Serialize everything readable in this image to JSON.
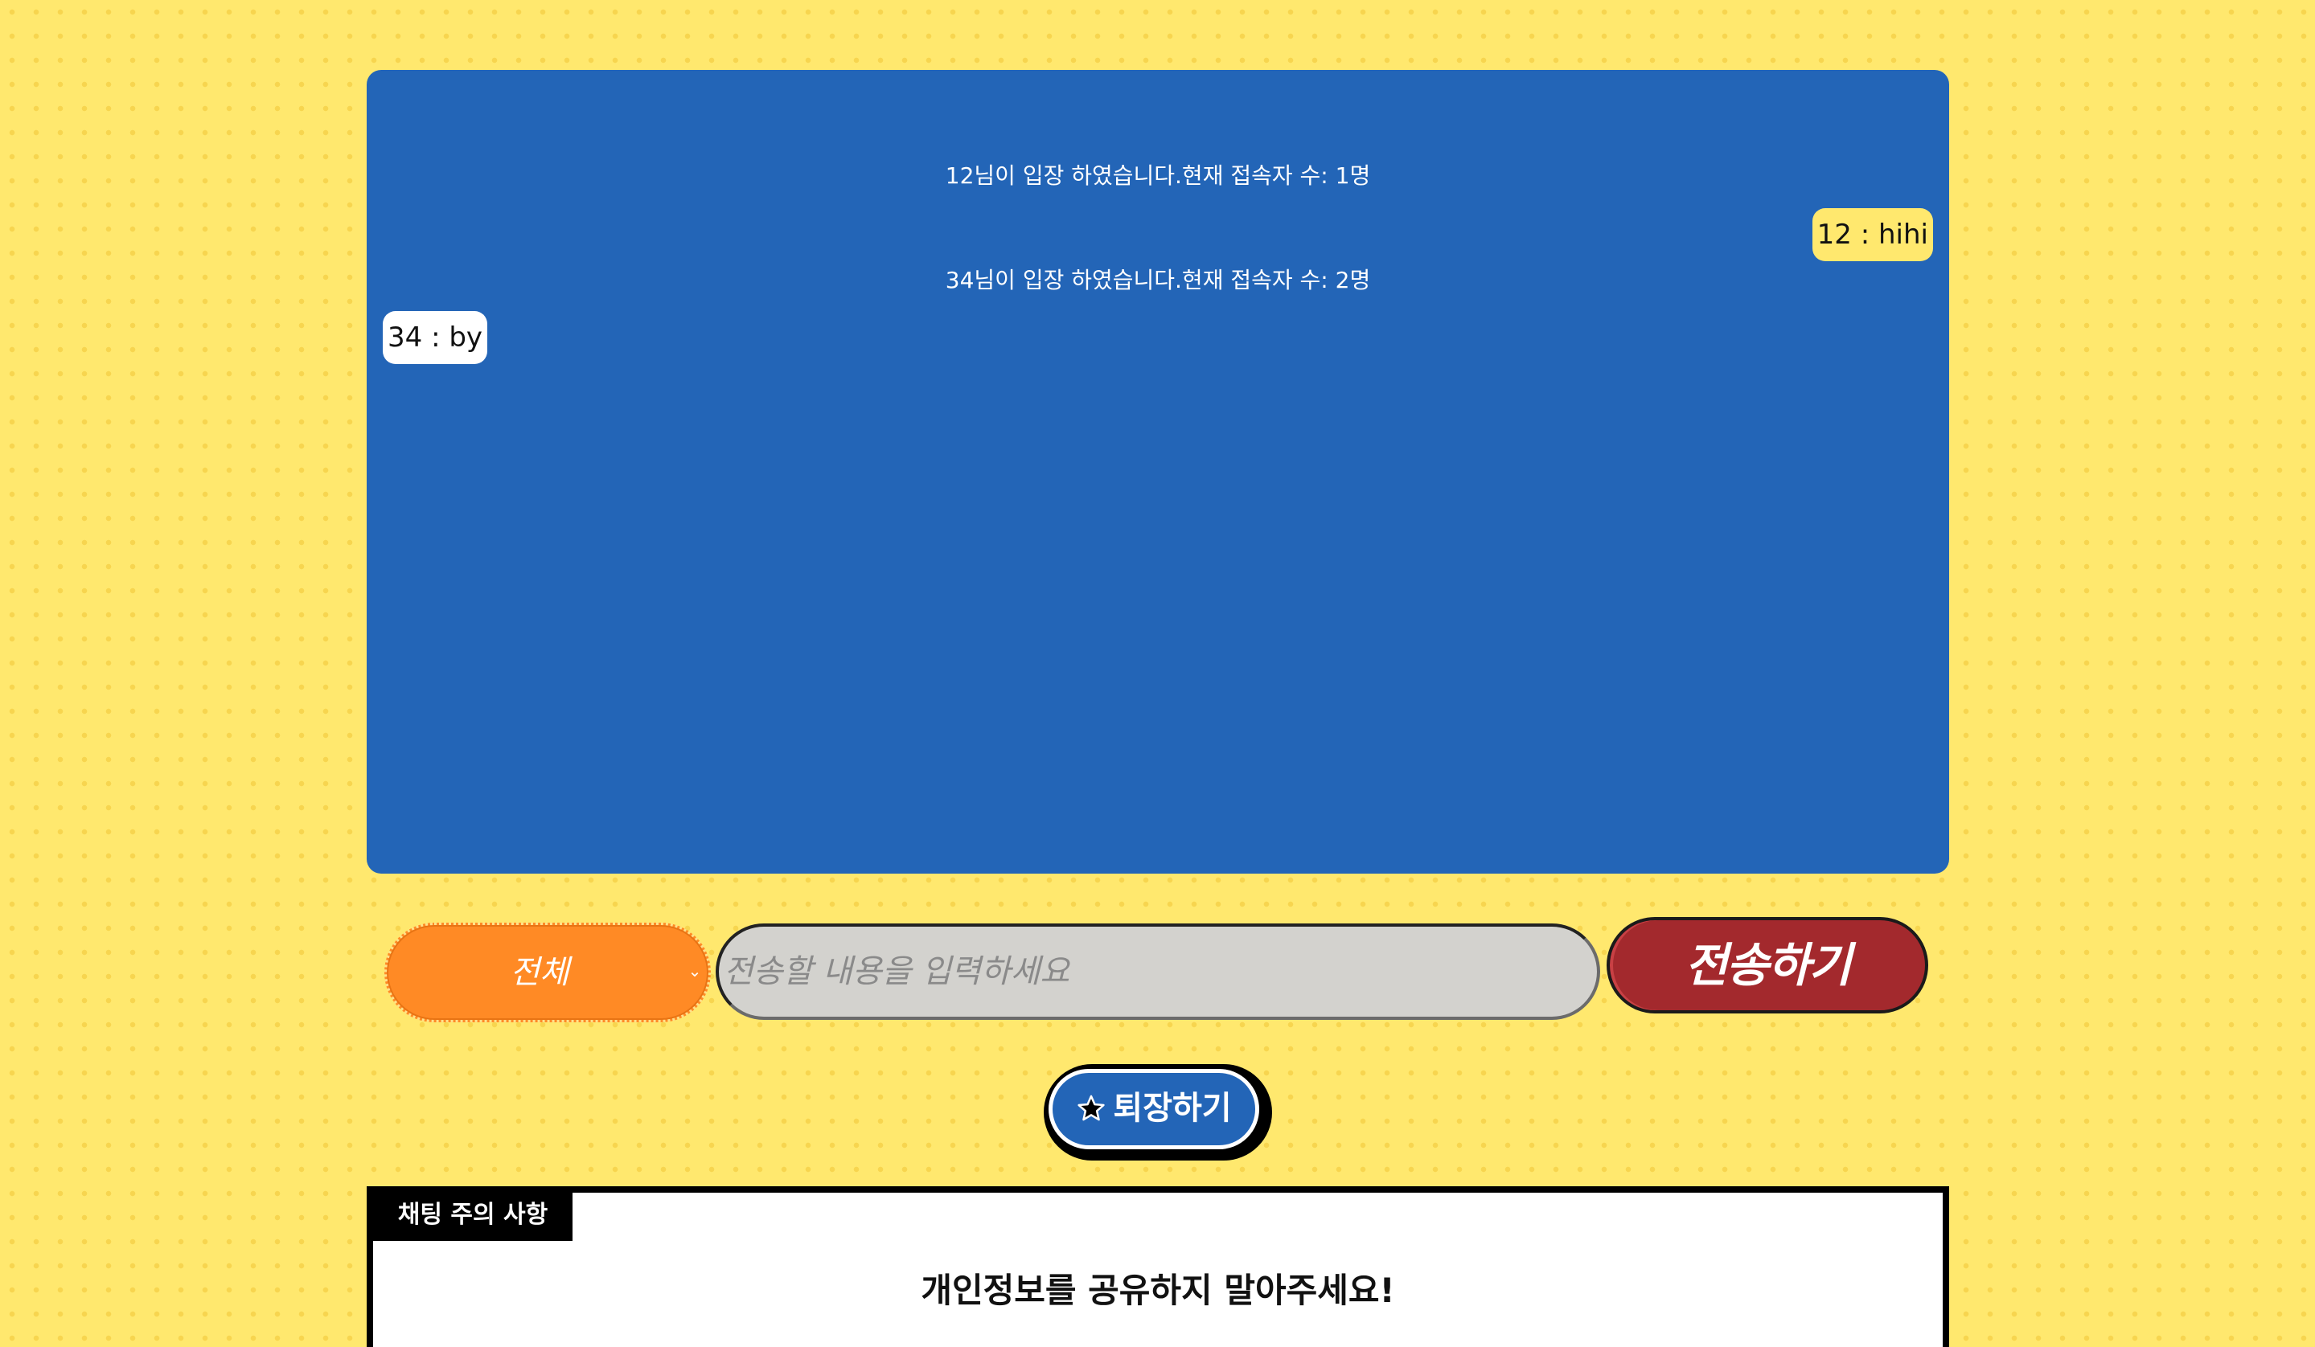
{
  "chat": {
    "messages": [
      {
        "type": "system",
        "text": "12님이 입장 하였습니다.현재 접속자 수: 1명"
      },
      {
        "type": "mine",
        "text": "12 : hihi"
      },
      {
        "type": "system",
        "text": "34님이 입장 하였습니다.현재 접속자 수: 2명"
      },
      {
        "type": "other",
        "text": "34 : by"
      }
    ]
  },
  "composer": {
    "target_select_value": "전체",
    "message_placeholder": "전송할 내용을 입력하세요",
    "send_label": "전송하기"
  },
  "exit": {
    "label": "퇴장하기",
    "icon": "star-icon"
  },
  "notice": {
    "tab_label": "채팅 주의 사항",
    "heading": "개인정보를 공유하지 말아주세요!"
  },
  "colors": {
    "background": "#ffe86e",
    "chat_panel": "#2365b7",
    "my_bubble": "#ffe86e",
    "other_bubble": "#ffffff",
    "select": "#ff8a25",
    "input": "#d3d2ce",
    "send_button": "#a3292d"
  }
}
